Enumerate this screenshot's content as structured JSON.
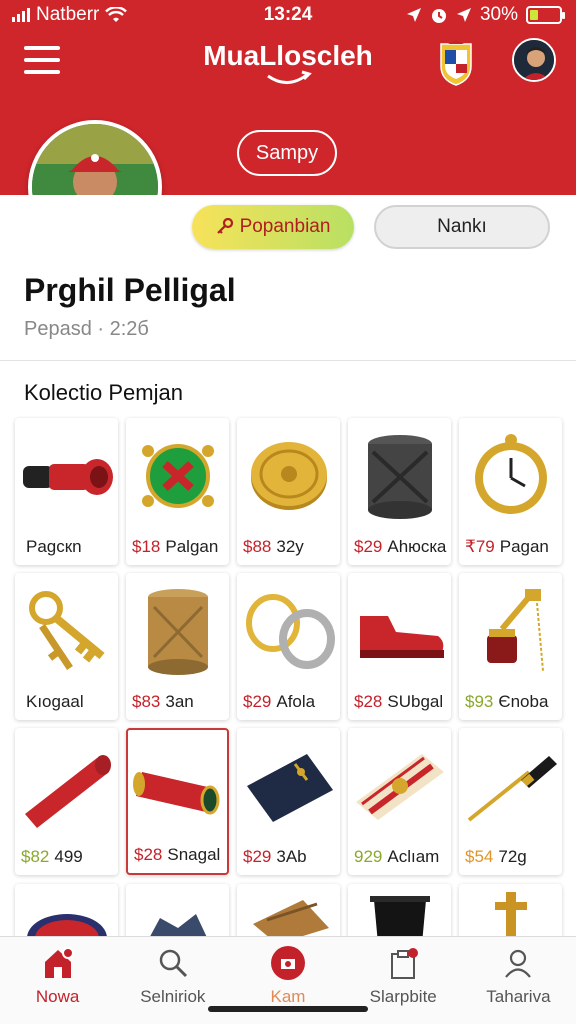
{
  "status_bar": {
    "carrier": "Natberr",
    "time": "13:24",
    "battery": "30%",
    "battery_level": 0.3
  },
  "header": {
    "title": "MuaLloscleh",
    "tag_label": "Sampy"
  },
  "actions": {
    "primary_label": "Popanbian",
    "secondary_label": "Nankı"
  },
  "profile": {
    "name": "Prghil Pelligal",
    "meta": "Pepasd · 2:2б"
  },
  "collection": {
    "title": "Kolectio Pemjan",
    "items": [
      {
        "icon": "cannon-pipe-icon",
        "price": "",
        "label": "Pagcкn",
        "price_color": "red"
      },
      {
        "icon": "green-ornament-icon",
        "price": "$18",
        "label": "Palgan",
        "price_color": "red"
      },
      {
        "icon": "gold-coin-icon",
        "price": "$88",
        "label": "32y",
        "price_color": "red"
      },
      {
        "icon": "iron-crate-icon",
        "price": "$29",
        "label": "Ahюcкa",
        "price_color": "red"
      },
      {
        "icon": "gold-clock-icon",
        "price": "₹79",
        "label": "Pagan",
        "price_color": "red"
      },
      {
        "icon": "keys-icon",
        "price": "",
        "label": "Kıogaal",
        "price_color": "red"
      },
      {
        "icon": "wooden-box-icon",
        "price": "$83",
        "label": "3an",
        "price_color": "red"
      },
      {
        "icon": "rings-icon",
        "price": "$29",
        "label": "Afola",
        "price_color": "red"
      },
      {
        "icon": "red-shoe-icon",
        "price": "$28",
        "label": "SUbgal",
        "price_color": "red"
      },
      {
        "icon": "brass-trinket-icon",
        "price": "$93",
        "label": "Єnoba",
        "price_color": "green"
      },
      {
        "icon": "red-tube-icon",
        "price": "$82",
        "label": "499",
        "price_color": "green"
      },
      {
        "icon": "red-cylinder-icon",
        "price": "$28",
        "label": "Snagal",
        "price_color": "red",
        "selected": true
      },
      {
        "icon": "navy-wallet-icon",
        "price": "$29",
        "label": "3Ab",
        "price_color": "red"
      },
      {
        "icon": "scarf-icon",
        "price": "929",
        "label": "Aclıam",
        "price_color": "green"
      },
      {
        "icon": "pen-icon",
        "price": "$54",
        "label": "72g",
        "price_color": "orange"
      }
    ]
  },
  "bottom_nav": [
    {
      "label": "Nowa",
      "icon": "home-icon",
      "state": "active"
    },
    {
      "label": "Selniriok",
      "icon": "search-icon",
      "state": "normal"
    },
    {
      "label": "Kam",
      "icon": "camera-icon",
      "state": "mid"
    },
    {
      "label": "Slarpbite",
      "icon": "clipboard-icon",
      "state": "normal"
    },
    {
      "label": "Tahariva",
      "icon": "user-icon",
      "state": "normal"
    }
  ],
  "colors": {
    "brand_red": "#cf262b",
    "price_red": "#c4222a",
    "price_green": "#8aa82b",
    "price_orange": "#e0952a"
  }
}
